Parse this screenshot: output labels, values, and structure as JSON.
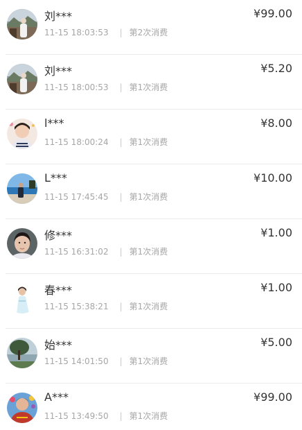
{
  "records": [
    {
      "name": "刘***",
      "time": "11-15 18:03:53",
      "sep": "|",
      "count": "第2次消费",
      "amount": "¥99.00",
      "avatar": "landscape-person-icon"
    },
    {
      "name": "刘***",
      "time": "11-15 18:00:53",
      "sep": "|",
      "count": "第1次消费",
      "amount": "¥5.20",
      "avatar": "landscape-person-icon"
    },
    {
      "name": "l***",
      "time": "11-15 18:00:24",
      "sep": "|",
      "count": "第1次消费",
      "amount": "¥8.00",
      "avatar": "child-portrait-icon"
    },
    {
      "name": "L***",
      "time": "11-15 17:45:45",
      "sep": "|",
      "count": "第1次消费",
      "amount": "¥10.00",
      "avatar": "beach-person-icon"
    },
    {
      "name": "修***",
      "time": "11-15 16:31:02",
      "sep": "|",
      "count": "第1次消费",
      "amount": "¥1.00",
      "avatar": "woman-portrait-icon"
    },
    {
      "name": "春***",
      "time": "11-15 15:38:21",
      "sep": "|",
      "count": "第1次消费",
      "amount": "¥1.00",
      "avatar": "woman-white-dress-icon"
    },
    {
      "name": "始***",
      "time": "11-15 14:01:50",
      "sep": "|",
      "count": "第1次消费",
      "amount": "¥5.00",
      "avatar": "tree-lake-icon"
    },
    {
      "name": "A***",
      "time": "11-15 13:49:50",
      "sep": "|",
      "count": "第1次消费",
      "amount": "¥99.00",
      "avatar": "colorful-person-icon"
    }
  ]
}
